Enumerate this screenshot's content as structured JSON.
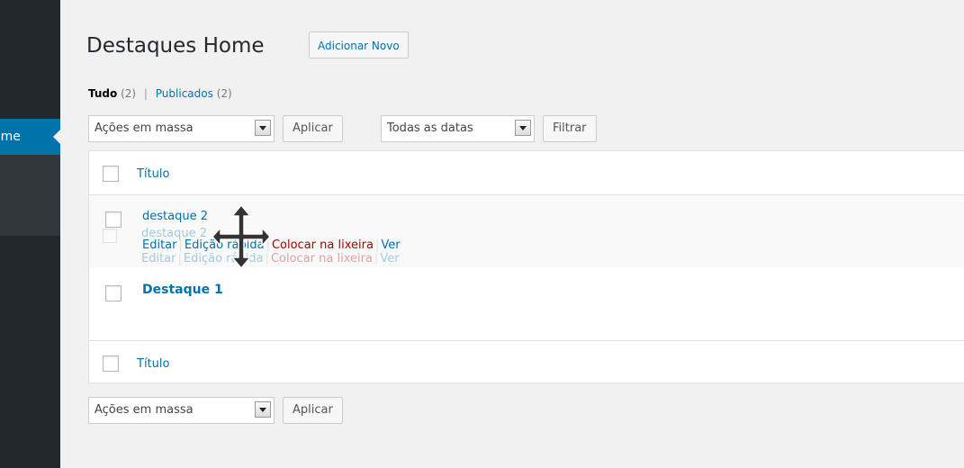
{
  "sidebar": {
    "current_item_label": "ome"
  },
  "header": {
    "title": "Destaques Home",
    "add_new_label": "Adicionar Novo"
  },
  "views": {
    "all_label": "Tudo",
    "all_count": "(2)",
    "separator": "|",
    "published_label": "Publicados",
    "published_count": "(2)"
  },
  "tablenav_top": {
    "bulk_actions_selected": "Ações em massa",
    "apply_label": "Aplicar",
    "dates_selected": "Todas as datas",
    "filter_label": "Filtrar"
  },
  "table": {
    "column_title": "Título",
    "rows": [
      {
        "title": "destaque 2",
        "actions": {
          "edit": "Editar",
          "quick_edit": "Edição rápida",
          "trash": "Colocar na lixeira",
          "view": "Ver"
        }
      },
      {
        "title": "Destaque 1"
      }
    ]
  },
  "drag_ghost": {
    "title": "destaque 2",
    "actions": {
      "edit": "Editar",
      "quick_edit": "Edição rápida",
      "trash": "Colocar na lixeira",
      "view": "Ver"
    }
  },
  "tablenav_bottom": {
    "bulk_actions_selected": "Ações em massa",
    "apply_label": "Aplicar"
  },
  "icons": {
    "move_cursor": "move-icon",
    "dropdown": "chevron-down-icon",
    "checkbox": "checkbox-icon"
  },
  "colors": {
    "sidebar_bg": "#23282d",
    "accent": "#0073aa",
    "trash": "#aa0000",
    "page_bg": "#f1f1f1"
  }
}
